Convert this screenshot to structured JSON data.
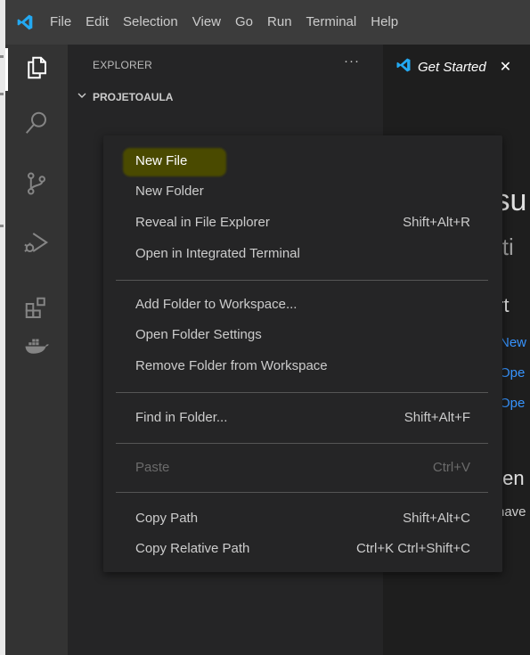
{
  "menubar": {
    "logo_icon": "vscode-logo-icon",
    "items": [
      "File",
      "Edit",
      "Selection",
      "View",
      "Go",
      "Run",
      "Terminal",
      "Help"
    ]
  },
  "activitybar": {
    "icons": [
      "files-icon",
      "search-icon",
      "source-control-icon",
      "run-debug-icon",
      "extensions-icon",
      "docker-icon"
    ]
  },
  "sidebar": {
    "title": "EXPLORER",
    "more_label": "···",
    "folder_chevron": "chevron-down-icon",
    "folder_name": "PROJETOAULA"
  },
  "editor": {
    "tab_label": "Get Started",
    "tab_close": "✕",
    "fragments": [
      "isu",
      "iti",
      "rt",
      "New",
      "Ope",
      "Ope",
      "ten",
      "nave"
    ]
  },
  "context_menu": {
    "items": [
      {
        "label": "New File",
        "shortcut": ""
      },
      {
        "label": "New Folder",
        "shortcut": ""
      },
      {
        "label": "Reveal in File Explorer",
        "shortcut": "Shift+Alt+R"
      },
      {
        "label": "Open in Integrated Terminal",
        "shortcut": ""
      },
      {
        "label": "Add Folder to Workspace...",
        "shortcut": ""
      },
      {
        "label": "Open Folder Settings",
        "shortcut": ""
      },
      {
        "label": "Remove Folder from Workspace",
        "shortcut": ""
      },
      {
        "label": "Find in Folder...",
        "shortcut": "Shift+Alt+F"
      },
      {
        "label": "Paste",
        "shortcut": "Ctrl+V"
      },
      {
        "label": "Copy Path",
        "shortcut": "Shift+Alt+C"
      },
      {
        "label": "Copy Relative Path",
        "shortcut": "Ctrl+K Ctrl+Shift+C"
      }
    ]
  },
  "colors": {
    "accent_blue": "#3794ff",
    "highlight": "#4a4a00"
  }
}
